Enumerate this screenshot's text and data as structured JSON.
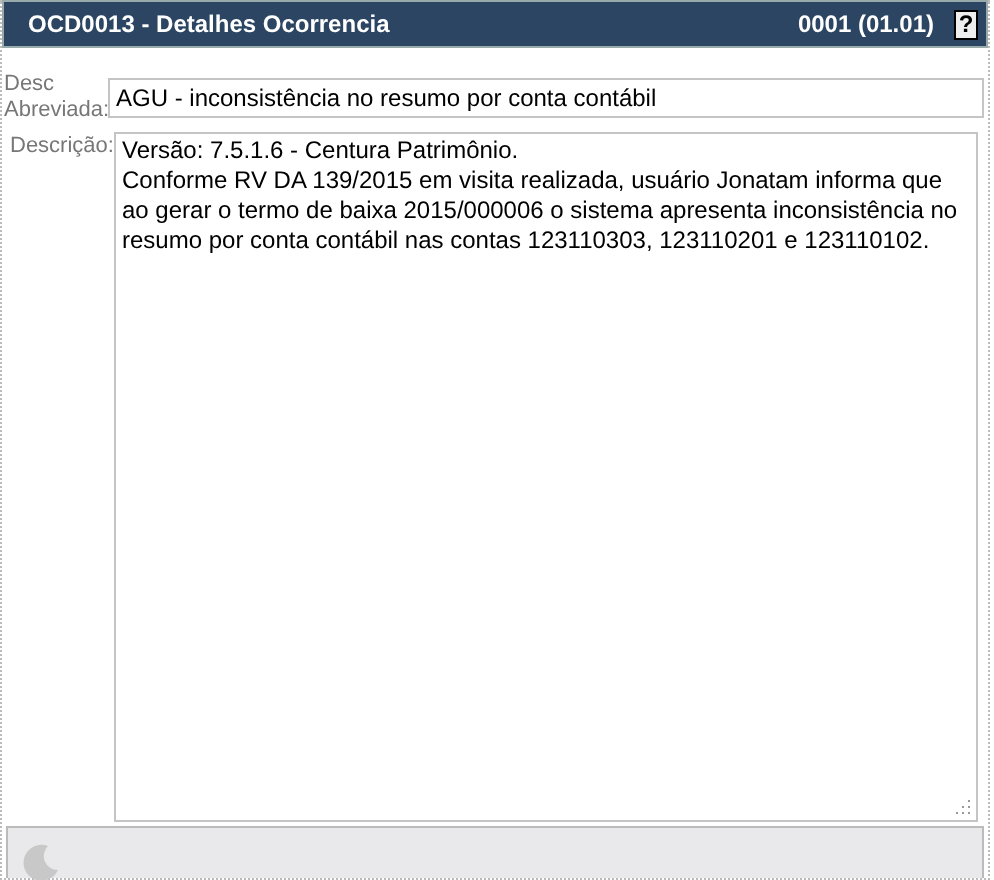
{
  "window": {
    "title": "OCD0013 - Detalhes Ocorrencia",
    "version": "0001 (01.01)",
    "help": "?"
  },
  "fields": [
    {
      "kind": "line",
      "label": "Desc Abreviada:",
      "value": "AGU -  inconsistência no resumo por conta contábil"
    },
    {
      "kind": "area",
      "label": "Descrição:",
      "value": "Versão: 7.5.1.6 - Centura Patrimônio.\nConforme RV DA 139/2015 em visita realizada, usuário Jonatam informa que ao gerar o termo de baixa 2015/000006 o sistema apresenta inconsistência no resumo por conta contábil nas contas 123110303, 123110201 e 123110102."
    }
  ],
  "status_bar": {
    "loading": true
  }
}
